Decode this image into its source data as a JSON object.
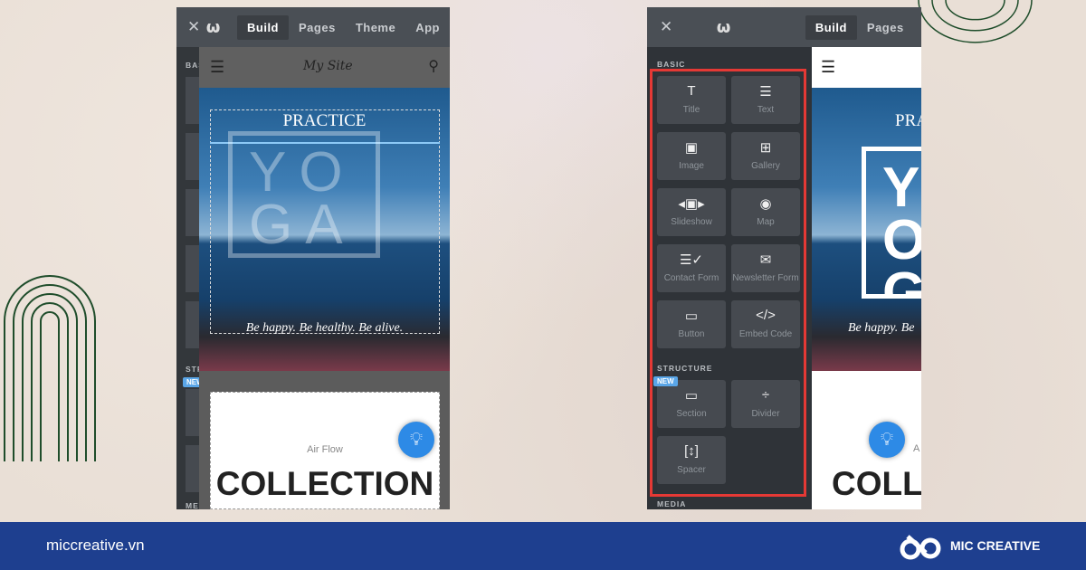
{
  "left_editor": {
    "tabs": [
      {
        "label": "Build",
        "active": true
      },
      {
        "label": "Pages"
      },
      {
        "label": "Theme"
      },
      {
        "label": "App"
      }
    ],
    "sidebar_sections": [
      "BAS",
      "STR",
      "MED"
    ],
    "new_badge": "NEW",
    "site_title": "My Site",
    "hero": {
      "heading": "PRACTICE",
      "overlay_text": "YOGA",
      "tagline": "Be happy. Be healthy. Be alive."
    },
    "card": {
      "subtitle": "Air Flow",
      "title": "COLLECTION"
    }
  },
  "right_editor": {
    "tabs": [
      {
        "label": "Build",
        "active": true
      },
      {
        "label": "Pages"
      }
    ],
    "basic_label": "BASIC",
    "basic_elements": [
      {
        "label": "Title",
        "icon": "title-icon"
      },
      {
        "label": "Text",
        "icon": "text-icon"
      },
      {
        "label": "Image",
        "icon": "image-icon"
      },
      {
        "label": "Gallery",
        "icon": "gallery-icon"
      },
      {
        "label": "Slideshow",
        "icon": "slideshow-icon"
      },
      {
        "label": "Map",
        "icon": "map-pin-icon"
      },
      {
        "label": "Contact Form",
        "icon": "contact-form-icon"
      },
      {
        "label": "Newsletter Form",
        "icon": "envelope-icon"
      },
      {
        "label": "Button",
        "icon": "button-icon"
      },
      {
        "label": "Embed Code",
        "icon": "code-icon"
      }
    ],
    "structure_label": "STRUCTURE",
    "new_badge": "NEW",
    "structure_elements": [
      {
        "label": "Section",
        "icon": "section-icon"
      },
      {
        "label": "Divider",
        "icon": "divider-icon"
      },
      {
        "label": "Spacer",
        "icon": "spacer-icon"
      }
    ],
    "media_label": "MEDIA",
    "hero": {
      "heading": "PRA",
      "overlay_text": "YOG",
      "tagline": "Be happy. Be"
    },
    "card": {
      "subtitle": "A",
      "title": "COLL"
    },
    "highlight_color": "#e53935"
  },
  "footer": {
    "website": "miccreative.vn",
    "brand": "MIC CREATIVE",
    "color": "#1e3f8f"
  }
}
